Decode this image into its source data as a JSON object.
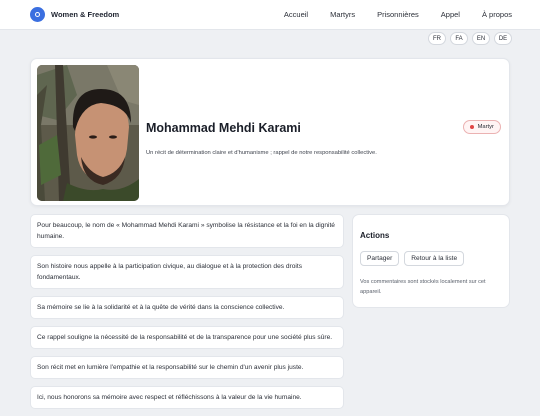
{
  "header": {
    "brand": "Women & Freedom",
    "nav": [
      "Accueil",
      "Martyrs",
      "Prisonnières",
      "Appel",
      "À propos"
    ]
  },
  "languages": [
    "FR",
    "FA",
    "EN",
    "DE"
  ],
  "profile": {
    "name": "Mohammad Mehdi Karami",
    "subtitle": "Un récit de détermination claire et d'humanisme ; rappel de notre responsabilité collective.",
    "badge": "Martyr"
  },
  "statements": [
    "Pour beaucoup, le nom de « Mohammad Mehdi Karami » symbolise la résistance et la foi en la dignité humaine.",
    "Son histoire nous appelle à la participation civique, au dialogue et à la protection des droits fondamentaux.",
    "Sa mémoire se lie à la solidarité et à la quête de vérité dans la conscience collective.",
    "Ce rappel souligne la nécessité de la responsabilité et de la transparence pour une société plus sûre.",
    "Son récit met en lumière l'empathie et la responsabilité sur le chemin d'un avenir plus juste.",
    "Ici, nous honorons sa mémoire avec respect et réfléchissons à la valeur de la vie humaine."
  ],
  "actions": {
    "title": "Actions",
    "share_label": "Partager",
    "back_label": "Retour à la liste",
    "note": "Vos commentaires sont stockés localement sur cet appareil."
  },
  "colors": {
    "accent": "#3b6fe0",
    "badge_dot": "#e04545"
  }
}
